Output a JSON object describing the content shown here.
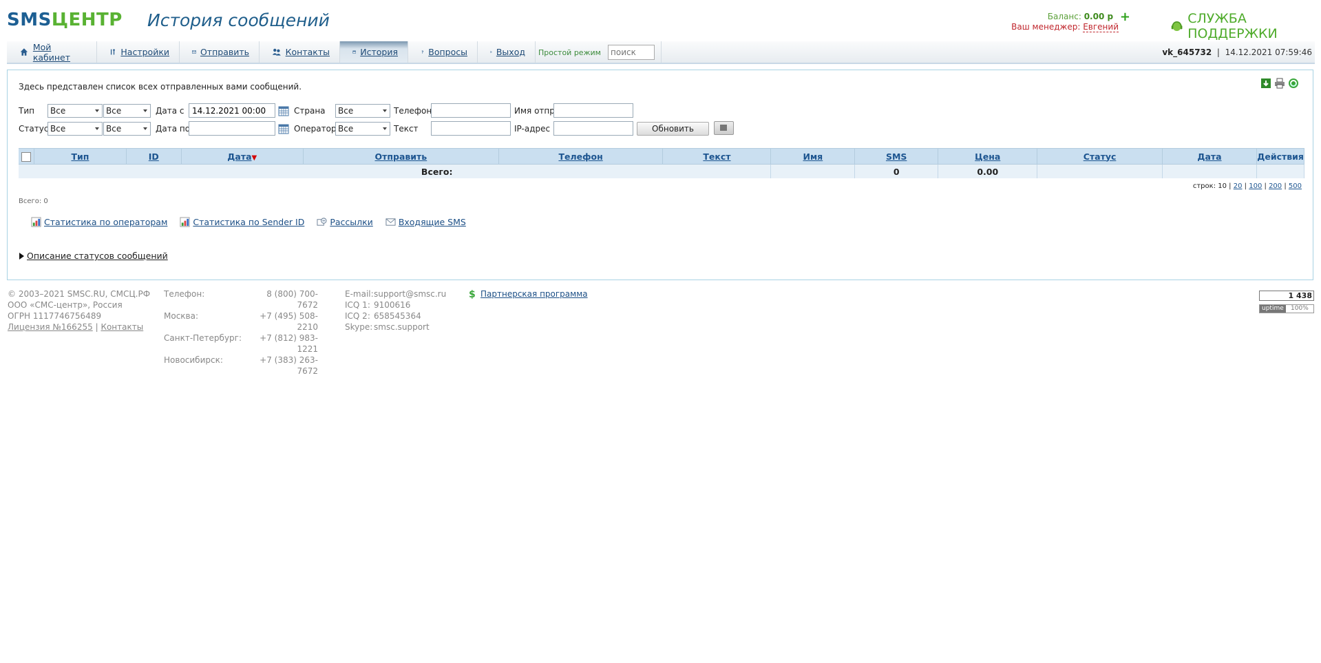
{
  "header": {
    "logo_sms": "SMS",
    "logo_center": "ЦЕНТР",
    "title": "История сообщений",
    "balance_label": "Баланс:",
    "balance_value": "0.00 р",
    "balance_plus": "+",
    "manager_label": "Ваш менеджер:",
    "manager_name": "Евгений",
    "support": "СЛУЖБА ПОДДЕРЖКИ"
  },
  "menu": {
    "items": [
      {
        "label": "Мой кабинет",
        "icon": "home-icon"
      },
      {
        "label": "Настройки",
        "icon": "tools-icon"
      },
      {
        "label": "Отправить",
        "icon": "envelope-icon"
      },
      {
        "label": "Контакты",
        "icon": "contacts-icon"
      },
      {
        "label": "История",
        "icon": "calendar-icon"
      },
      {
        "label": "Вопросы",
        "icon": "question-icon"
      },
      {
        "label": "Выход",
        "icon": "exit-icon"
      }
    ],
    "active": "История",
    "simple_mode": "Простой режим",
    "search_placeholder": "поиск",
    "username": "vk_645732",
    "separator": "|",
    "datetime": "14.12.2021 07:59:46"
  },
  "filters": {
    "intro": "Здесь представлен список всех отправленных вами сообщений.",
    "type_label": "Тип",
    "type_value1": "Все",
    "type_value2": "Все",
    "date_from_label": "Дата с",
    "date_from_value": "14.12.2021 00:00",
    "country_label": "Страна",
    "country_value": "Все",
    "phone_label": "Телефон",
    "sender_label": "Имя отпр.",
    "status_label": "Статус",
    "status_value1": "Все",
    "status_value2": "Все",
    "date_to_label": "Дата по",
    "operator_label": "Оператор",
    "operator_value": "Все",
    "text_label": "Текст",
    "ip_label": "IP-адрес",
    "refresh_button": "Обновить"
  },
  "table": {
    "columns": [
      "Тип",
      "ID",
      "Дата",
      "Отправить",
      "Телефон",
      "Текст",
      "Имя",
      "SMS",
      "Цена",
      "Статус",
      "Дата",
      "Действия"
    ],
    "sort_arrow": "▼",
    "total_label": "Всего:",
    "total_sms": "0",
    "total_price": "0.00",
    "rows_label": "строк:",
    "rows_options": [
      "10",
      "20",
      "100",
      "200",
      "500"
    ],
    "rows_sep": "|",
    "total_small": "Всего: 0"
  },
  "links": [
    {
      "label": "Статистика по операторам",
      "icon": "chart-icon"
    },
    {
      "label": "Статистика по Sender ID",
      "icon": "chart-icon"
    },
    {
      "label": "Рассылки",
      "icon": "broadcast-icon"
    },
    {
      "label": "Входящие SMS",
      "icon": "envelope-icon"
    }
  ],
  "status_desc": "Описание статусов сообщений",
  "footer": {
    "col1": [
      "© 2003–2021 SMSC.RU, СМСЦ.РФ",
      "ООО «СМС-центр», Россия",
      "ОГРН 1117746756489"
    ],
    "license": "Лицензия №166255",
    "license_sep": "|",
    "contacts_link": "Контакты",
    "phones": [
      {
        "city": "Телефон:",
        "num": "8 (800) 700-7672"
      },
      {
        "city": "Москва:",
        "num": "+7 (495) 508-2210"
      },
      {
        "city": "Санкт-Петербург:",
        "num": "+7 (812) 983-1221"
      },
      {
        "city": "Новосибирск:",
        "num": "+7 (383) 263-7672"
      }
    ],
    "contacts": [
      {
        "k": "E-mail:",
        "v": "support@smsc.ru"
      },
      {
        "k": "ICQ 1:",
        "v": "9100616"
      },
      {
        "k": "ICQ 2:",
        "v": "658545364"
      },
      {
        "k": "Skype:",
        "v": "smsc.support"
      }
    ],
    "partner": "Партнерская программа",
    "counter": "1 438",
    "uptime_label": "uptime",
    "uptime_value": "100%"
  },
  "colors": {
    "accent": "#1d5f93",
    "green": "#59b233",
    "table_head": "#cadff0"
  }
}
